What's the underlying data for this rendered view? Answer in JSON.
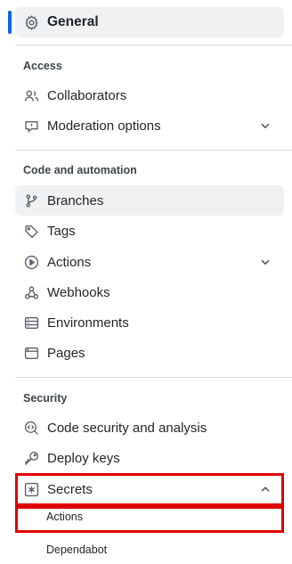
{
  "general": {
    "label": "General",
    "icon": "gear-icon"
  },
  "access": {
    "heading": "Access",
    "items": [
      {
        "label": "Collaborators",
        "icon": "people-icon"
      },
      {
        "label": "Moderation options",
        "icon": "report-icon"
      }
    ]
  },
  "code": {
    "heading": "Code and automation",
    "items": [
      {
        "label": "Branches",
        "icon": "git-branch-icon"
      },
      {
        "label": "Tags",
        "icon": "tag-icon"
      },
      {
        "label": "Actions",
        "icon": "play-icon"
      },
      {
        "label": "Webhooks",
        "icon": "webhook-icon"
      },
      {
        "label": "Environments",
        "icon": "server-icon"
      },
      {
        "label": "Pages",
        "icon": "browser-icon"
      }
    ]
  },
  "security": {
    "heading": "Security",
    "items": [
      {
        "label": "Code security and analysis",
        "icon": "codescan-icon"
      },
      {
        "label": "Deploy keys",
        "icon": "key-icon"
      },
      {
        "label": "Secrets",
        "icon": "key-asterisk-icon"
      }
    ],
    "secrets_sub": [
      {
        "label": "Actions"
      },
      {
        "label": "Dependabot"
      }
    ]
  },
  "colors": {
    "accent": "#0969da",
    "highlight_border": "#e00000",
    "active_bg": "#f0f1f3"
  }
}
